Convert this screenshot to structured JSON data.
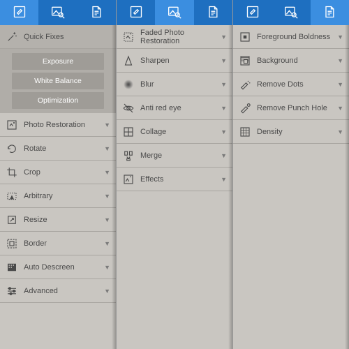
{
  "panels": [
    {
      "tabs": [
        "edit",
        "image-search",
        "document"
      ],
      "activeTab": 0,
      "header": {
        "icon": "wand-icon",
        "label": "Quick Fixes",
        "expanded": true
      },
      "subitems": [
        "Exposure",
        "White Balance",
        "Optimization"
      ],
      "items": [
        {
          "icon": "restore-icon",
          "label": "Photo Restoration"
        },
        {
          "icon": "rotate-icon",
          "label": "Rotate"
        },
        {
          "icon": "crop-icon",
          "label": "Crop"
        },
        {
          "icon": "arbitrary-icon",
          "label": "Arbitrary"
        },
        {
          "icon": "resize-icon",
          "label": "Resize"
        },
        {
          "icon": "border-icon",
          "label": "Border"
        },
        {
          "icon": "descreen-icon",
          "label": "Auto Descreen"
        },
        {
          "icon": "advanced-icon",
          "label": "Advanced"
        }
      ]
    },
    {
      "tabs": [
        "edit",
        "image-search",
        "document"
      ],
      "activeTab": 1,
      "items": [
        {
          "icon": "faded-icon",
          "label": "Faded Photo Restoration"
        },
        {
          "icon": "sharpen-icon",
          "label": "Sharpen"
        },
        {
          "icon": "blur-icon",
          "label": "Blur"
        },
        {
          "icon": "redeye-icon",
          "label": "Anti red eye"
        },
        {
          "icon": "collage-icon",
          "label": "Collage"
        },
        {
          "icon": "merge-icon",
          "label": "Merge"
        },
        {
          "icon": "effects-icon",
          "label": "Effects"
        }
      ]
    },
    {
      "tabs": [
        "edit",
        "image-search",
        "document"
      ],
      "activeTab": 2,
      "items": [
        {
          "icon": "foreground-icon",
          "label": "Foreground Boldness"
        },
        {
          "icon": "background-icon",
          "label": "Background"
        },
        {
          "icon": "dots-icon",
          "label": "Remove Dots"
        },
        {
          "icon": "punch-icon",
          "label": "Remove Punch Hole"
        },
        {
          "icon": "density-icon",
          "label": "Density"
        }
      ]
    }
  ]
}
